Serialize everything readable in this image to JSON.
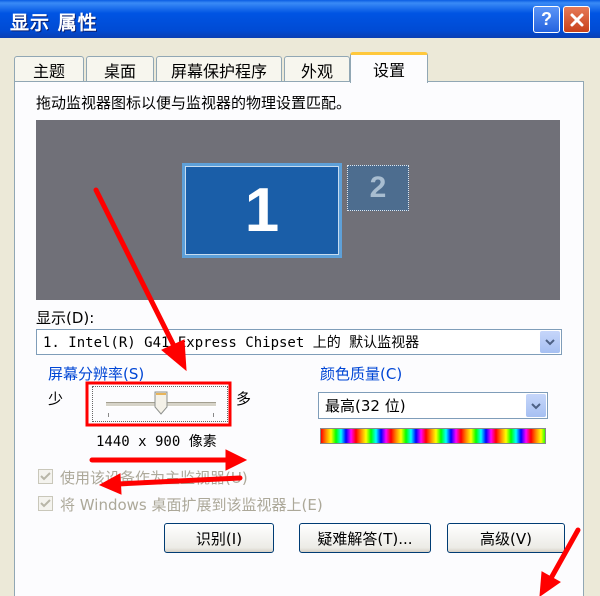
{
  "window": {
    "title": "显示 属性"
  },
  "tabs": [
    {
      "label": "主题"
    },
    {
      "label": "桌面"
    },
    {
      "label": "屏幕保护程序"
    },
    {
      "label": "外观"
    },
    {
      "label": "设置"
    }
  ],
  "settings": {
    "instruction": "拖动监视器图标以便与监视器的物理设置匹配。",
    "monitors": [
      {
        "number": "1"
      },
      {
        "number": "2"
      }
    ],
    "display_label": "显示(D):",
    "display_value": "1. Intel(R) G41 Express Chipset 上的 默认监视器",
    "resolution": {
      "label": "屏幕分辨率(S)",
      "less": "少",
      "more": "多",
      "value": "1440 x 900 像素",
      "slider_position": 0.5
    },
    "color_quality": {
      "label": "颜色质量(C)",
      "value": "最高(32 位)"
    },
    "checkboxes": [
      {
        "label": "使用该设备作为主监视器(U)",
        "checked": true,
        "enabled": false
      },
      {
        "label": "将 Windows 桌面扩展到该监视器上(E)",
        "checked": true,
        "enabled": false
      }
    ],
    "buttons": {
      "identify": "识别(I)",
      "troubleshoot": "疑难解答(T)...",
      "advanced": "高级(V)"
    }
  },
  "colors": {
    "title_bar": "#0054e3",
    "accent_label": "#0046d5",
    "annotation_arrow": "#ff0000"
  }
}
